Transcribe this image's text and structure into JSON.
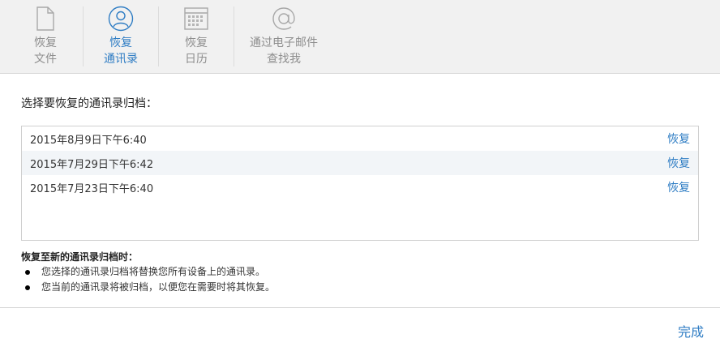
{
  "tabs": [
    {
      "line1": "恢复",
      "line2": "文件",
      "icon": "document-icon"
    },
    {
      "line1": "恢复",
      "line2": "通讯录",
      "icon": "contacts-icon"
    },
    {
      "line1": "恢复",
      "line2": "日历",
      "icon": "calendar-icon"
    },
    {
      "line1": "通过电子邮件",
      "line2": "查找我",
      "icon": "at-sign-icon"
    }
  ],
  "prompt": "选择要恢复的通讯录归档：",
  "archives": [
    {
      "date": "2015年8月9日下午6:40",
      "action": "恢复"
    },
    {
      "date": "2015年7月29日下午6:42",
      "action": "恢复"
    },
    {
      "date": "2015年7月23日下午6:40",
      "action": "恢复"
    }
  ],
  "notes": {
    "title": "恢复至新的通讯录归档时：",
    "items": [
      "您选择的通讯录归档将替换您所有设备上的通讯录。",
      "您当前的通讯录将被归档，以便您在需要时将其恢复。"
    ]
  },
  "done_label": "完成",
  "colors": {
    "accent": "#2f7dc4",
    "toolbar_bg": "#f1f1f1",
    "selected_row": "#f2f5f8"
  }
}
